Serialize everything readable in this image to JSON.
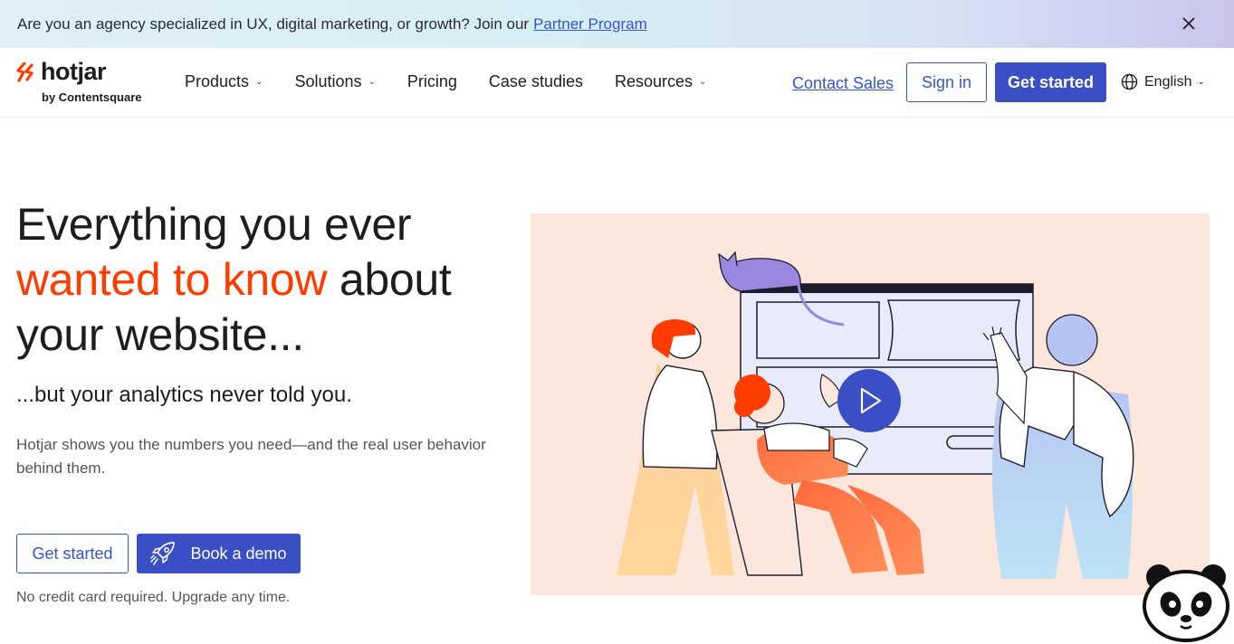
{
  "banner": {
    "text": "Are you an agency specialized in UX, digital marketing, or growth? Join our",
    "link": "Partner Program",
    "close_icon": "close-icon"
  },
  "nav": {
    "logo_word": "hotjar",
    "logo_sub": "by Contentsquare",
    "items": [
      {
        "label": "Products",
        "has_dropdown": true
      },
      {
        "label": "Solutions",
        "has_dropdown": true
      },
      {
        "label": "Pricing",
        "has_dropdown": false
      },
      {
        "label": "Case studies",
        "has_dropdown": false
      },
      {
        "label": "Resources",
        "has_dropdown": true
      }
    ],
    "contact_sales": "Contact Sales",
    "sign_in": "Sign in",
    "get_started": "Get started",
    "language": "English"
  },
  "hero": {
    "title_line1": "Everything you ever",
    "title_accent": "wanted to know",
    "title_after_accent": "about",
    "title_line3": "your website...",
    "subtitle": "...but your analytics never told you.",
    "description": "Hotjar shows you the numbers you need—and the real user behavior behind them.",
    "primary_cta": "Get started",
    "secondary_cta": "Book a demo",
    "note": "No credit card required. Upgrade any time."
  },
  "colors": {
    "brand_blue": "#3a4fc4",
    "accent_orange": "#ff3c00",
    "illustration_bg": "#fde7dd"
  }
}
